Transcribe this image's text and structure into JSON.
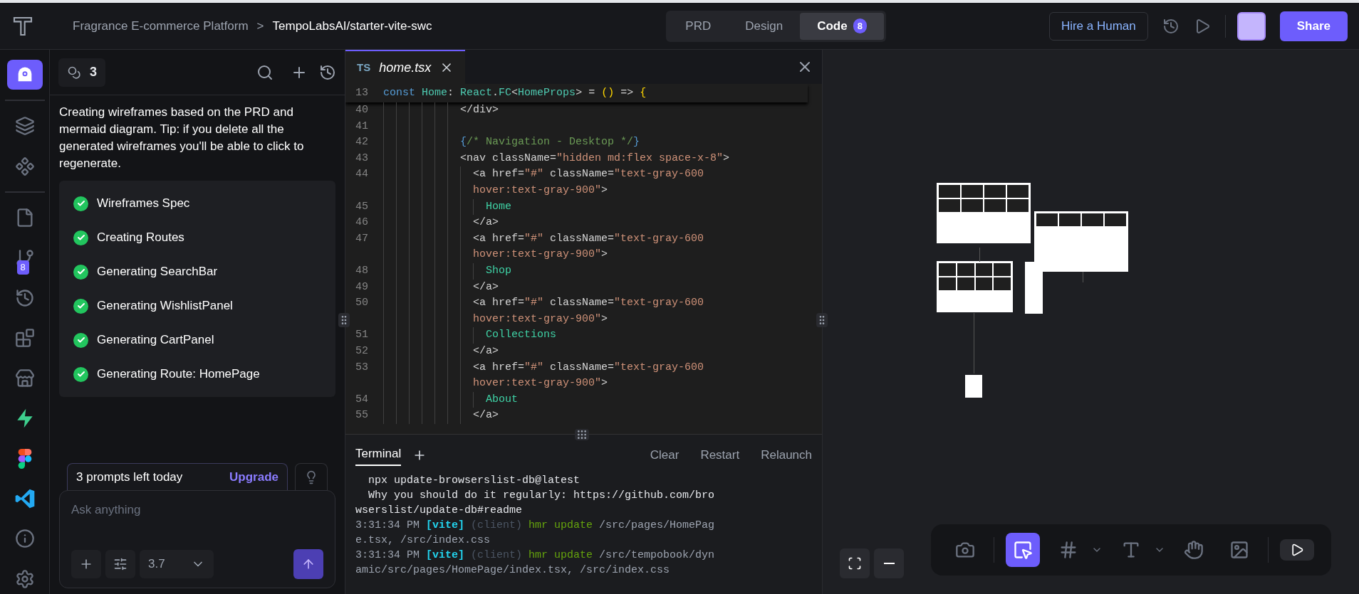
{
  "topbar": {
    "breadcrumb": [
      {
        "label": "Fragrance E-commerce Platform",
        "current": false
      },
      {
        "label": "TempoLabsAI/starter-vite-swc",
        "current": true
      }
    ],
    "separator": ">",
    "tabs": [
      {
        "label": "PRD",
        "selected": false
      },
      {
        "label": "Design",
        "selected": false
      },
      {
        "label": "Code",
        "selected": true,
        "badge": "8"
      }
    ],
    "hire_button": "Hire a Human",
    "share_button": "Share"
  },
  "rail": [
    {
      "kind": "app",
      "selected": true
    },
    {
      "kind": "layers",
      "selected": false
    },
    {
      "kind": "components",
      "selected": false
    },
    {
      "kind": "file",
      "selected": false
    },
    {
      "kind": "git",
      "selected": false,
      "badge": "8"
    },
    {
      "kind": "history",
      "selected": false
    },
    {
      "kind": "blocks",
      "selected": false
    },
    {
      "kind": "store",
      "selected": false
    },
    {
      "kind": "supabase",
      "selected": false
    },
    {
      "kind": "figma",
      "selected": false
    },
    {
      "kind": "vscode",
      "selected": false
    },
    {
      "kind": "info",
      "selected": false
    },
    {
      "kind": "settings",
      "selected": false
    }
  ],
  "chat": {
    "credits": "3",
    "message": "Creating wireframes based on the PRD and mermaid diagram. Tip: if you delete all the generated wireframes you'll be able to click to regenerate.",
    "steps": [
      {
        "label": "Wireframes Spec",
        "done": true
      },
      {
        "label": "Creating Routes",
        "done": true
      },
      {
        "label": "Generating SearchBar",
        "done": true
      },
      {
        "label": "Generating WishlistPanel",
        "done": true
      },
      {
        "label": "Generating CartPanel",
        "done": true
      },
      {
        "label": "Generating Route: HomePage",
        "done": true
      }
    ],
    "prompts_left": "3 prompts left today",
    "upgrade": "Upgrade",
    "input_placeholder": "Ask anything",
    "model": "3.7"
  },
  "editor": {
    "tab": {
      "badge": "TS",
      "name": "home.tsx",
      "selected": true
    },
    "sticky": {
      "number": "13",
      "tokens": [
        {
          "kind": "kw",
          "text": "const"
        },
        {
          "kind": "type",
          "text": " Home"
        },
        {
          "kind": "plain",
          "text": ": "
        },
        {
          "kind": "type",
          "text": "React"
        },
        {
          "kind": "plain",
          "text": "."
        },
        {
          "kind": "type",
          "text": "FC"
        },
        {
          "kind": "plain",
          "text": "<"
        },
        {
          "kind": "type",
          "text": "HomeProps"
        },
        {
          "kind": "plain",
          "text": "> = "
        },
        {
          "kind": "bracket",
          "text": "()"
        },
        {
          "kind": "plain",
          "text": " => "
        },
        {
          "kind": "bracket",
          "text": "{"
        }
      ]
    },
    "lines": [
      {
        "number": "40",
        "tokens": [
          {
            "kind": "plain",
            "text": "            </div>"
          }
        ]
      },
      {
        "number": "41"
      },
      {
        "number": "42",
        "tokens": [
          {
            "kind": "brace",
            "text": "            {"
          },
          {
            "kind": "comment",
            "text": "/* Navigation - Desktop */"
          },
          {
            "kind": "brace",
            "text": "}"
          }
        ]
      },
      {
        "number": "43",
        "tokens": [
          {
            "kind": "plain",
            "text": "            <nav className="
          },
          {
            "kind": "string",
            "text": "\"hidden md:flex space-x-8\""
          },
          {
            "kind": "plain",
            "text": ">"
          }
        ]
      },
      {
        "number": "44",
        "tokens": [
          {
            "kind": "plain",
            "text": "              <a href="
          },
          {
            "kind": "string",
            "text": "\"#\""
          },
          {
            "kind": "plain",
            "text": " className="
          },
          {
            "kind": "string",
            "text": "\"text-gray-600"
          }
        ]
      },
      {
        "tokens": [
          {
            "kind": "string",
            "text": "              hover:text-gray-900\""
          },
          {
            "kind": "plain",
            "text": ">"
          }
        ]
      },
      {
        "number": "45",
        "tokens": [
          {
            "kind": "text",
            "text": "                Home"
          }
        ]
      },
      {
        "number": "46",
        "tokens": [
          {
            "kind": "plain",
            "text": "              </a>"
          }
        ]
      },
      {
        "number": "47",
        "tokens": [
          {
            "kind": "plain",
            "text": "              <a href="
          },
          {
            "kind": "string",
            "text": "\"#\""
          },
          {
            "kind": "plain",
            "text": " className="
          },
          {
            "kind": "string",
            "text": "\"text-gray-600"
          }
        ]
      },
      {
        "tokens": [
          {
            "kind": "string",
            "text": "              hover:text-gray-900\""
          },
          {
            "kind": "plain",
            "text": ">"
          }
        ]
      },
      {
        "number": "48",
        "tokens": [
          {
            "kind": "text",
            "text": "                Shop"
          }
        ]
      },
      {
        "number": "49",
        "tokens": [
          {
            "kind": "plain",
            "text": "              </a>"
          }
        ]
      },
      {
        "number": "50",
        "tokens": [
          {
            "kind": "plain",
            "text": "              <a href="
          },
          {
            "kind": "string",
            "text": "\"#\""
          },
          {
            "kind": "plain",
            "text": " className="
          },
          {
            "kind": "string",
            "text": "\"text-gray-600"
          }
        ]
      },
      {
        "tokens": [
          {
            "kind": "string",
            "text": "              hover:text-gray-900\""
          },
          {
            "kind": "plain",
            "text": ">"
          }
        ]
      },
      {
        "number": "51",
        "tokens": [
          {
            "kind": "text",
            "text": "                Collections"
          }
        ]
      },
      {
        "number": "52",
        "tokens": [
          {
            "kind": "plain",
            "text": "              </a>"
          }
        ]
      },
      {
        "number": "53",
        "tokens": [
          {
            "kind": "plain",
            "text": "              <a href="
          },
          {
            "kind": "string",
            "text": "\"#\""
          },
          {
            "kind": "plain",
            "text": " className="
          },
          {
            "kind": "string",
            "text": "\"text-gray-600"
          }
        ]
      },
      {
        "tokens": [
          {
            "kind": "string",
            "text": "              hover:text-gray-900\""
          },
          {
            "kind": "plain",
            "text": ">"
          }
        ]
      },
      {
        "number": "54",
        "tokens": [
          {
            "kind": "text",
            "text": "                About"
          }
        ]
      },
      {
        "number": "55",
        "tokens": [
          {
            "kind": "plain",
            "text": "              </a>"
          }
        ]
      }
    ]
  },
  "terminal": {
    "tabs": [
      {
        "label": "Terminal",
        "selected": true
      }
    ],
    "actions": [
      "Clear",
      "Restart",
      "Relaunch"
    ],
    "lines": [
      [
        {
          "kind": "plain",
          "text": "  npx update-browserslist-db@latest"
        }
      ],
      [
        {
          "kind": "plain",
          "text": "  Why you should do it regularly: https://github.com/bro"
        }
      ],
      [
        {
          "kind": "plain",
          "text": "wserslist/update-db#readme"
        }
      ],
      [
        {
          "kind": "time",
          "text": "3:31:34 PM "
        },
        {
          "kind": "vite",
          "text": "[vite]"
        },
        {
          "kind": "client",
          "text": " (client)"
        },
        {
          "kind": "hmr",
          "text": " hmr update"
        },
        {
          "kind": "time",
          "text": " /src/pages/HomePag"
        }
      ],
      [
        {
          "kind": "time",
          "text": "e.tsx, /src/index.css"
        }
      ],
      [
        {
          "kind": "time",
          "text": "3:31:34 PM "
        },
        {
          "kind": "vite",
          "text": "[vite]"
        },
        {
          "kind": "client",
          "text": " (client)"
        },
        {
          "kind": "hmr",
          "text": " hmr update"
        },
        {
          "kind": "time",
          "text": " /src/tempobook/dyn"
        }
      ],
      [
        {
          "kind": "time",
          "text": "amic/src/pages/HomePage/index.tsx, /src/index.css"
        }
      ]
    ]
  },
  "canvas": {
    "tools": [
      {
        "kind": "camera",
        "selected": false
      },
      {
        "kind": "pointer",
        "selected": true
      },
      {
        "kind": "frame",
        "selected": false,
        "menu": true
      },
      {
        "kind": "text",
        "selected": false,
        "menu": true
      },
      {
        "kind": "hand",
        "selected": false
      },
      {
        "kind": "image",
        "selected": false
      },
      {
        "kind": "preview",
        "selected": false
      }
    ]
  }
}
